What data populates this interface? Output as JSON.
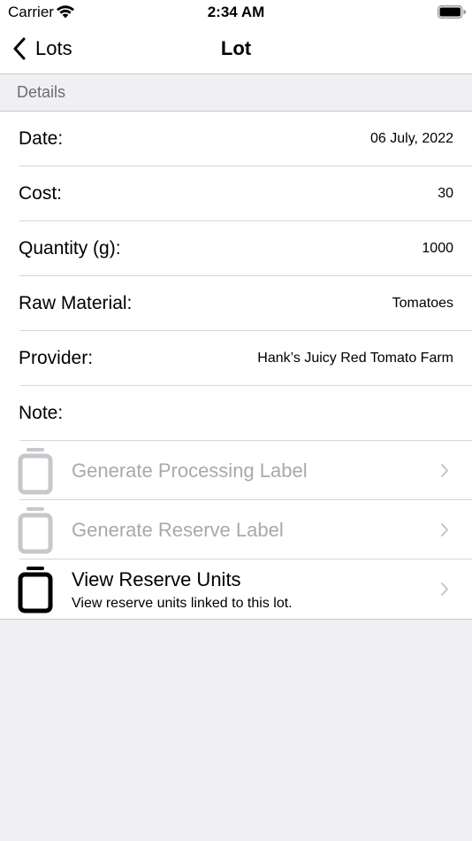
{
  "status_bar": {
    "carrier": "Carrier",
    "time": "2:34 AM",
    "wifi_icon": "wifi-icon",
    "battery_icon": "battery-icon"
  },
  "nav": {
    "back_label": "Lots",
    "title": "Lot"
  },
  "section": {
    "header": "Details"
  },
  "fields": [
    {
      "label": "Date:",
      "value": "06 July, 2022"
    },
    {
      "label": "Cost:",
      "value": "30"
    },
    {
      "label": "Quantity (g):",
      "value": "1000"
    },
    {
      "label": "Raw Material:",
      "value": "Tomatoes"
    },
    {
      "label": "Provider:",
      "value": "Hank’s Juicy Red Tomato Farm"
    },
    {
      "label": "Note:",
      "value": ""
    }
  ],
  "actions": [
    {
      "title": "Generate Processing Label",
      "subtitle": "",
      "enabled": false,
      "icon": "jar-icon"
    },
    {
      "title": "Generate Reserve Label",
      "subtitle": "",
      "enabled": false,
      "icon": "jar-icon"
    },
    {
      "title": "View Reserve Units",
      "subtitle": "View reserve units linked to this lot.",
      "enabled": true,
      "icon": "jar-icon"
    }
  ],
  "colors": {
    "background": "#efeff4",
    "disabled_text": "#a9a9ad",
    "disabled_icon": "#c7c7cc",
    "separator": "#c8c7cc",
    "section_text": "#6d6d72",
    "chevron": "#c4c4c7"
  }
}
